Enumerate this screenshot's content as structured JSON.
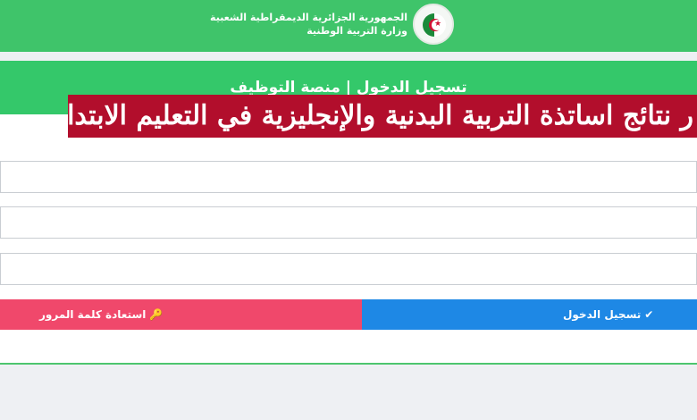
{
  "header": {
    "gov_line1": "الجمهورية الجزائرية الديمقراطية الشعبية",
    "gov_line2": "وزارة التربية الوطنية",
    "emblem_icon": "algeria-flag-emblem",
    "background": "#3fc46a"
  },
  "card": {
    "title": "تسجيل الدخول | منصة التوظيف",
    "header_color": "#34c86a"
  },
  "form": {
    "field1_value": "",
    "field2_value": "",
    "field3_value": ""
  },
  "headline_banner": {
    "text": "ر نتائج اساتذة التربية البدنية والإنجليزية في التعليم الابتدائي",
    "background": "#b20e2c"
  },
  "buttons": {
    "login_label": "تسجيل الدخول",
    "login_icon": "check-icon",
    "login_color": "#1e88e5",
    "reset_label": "استعادة كلمة المرور",
    "reset_icon": "key-icon",
    "reset_color": "#f0486b"
  }
}
